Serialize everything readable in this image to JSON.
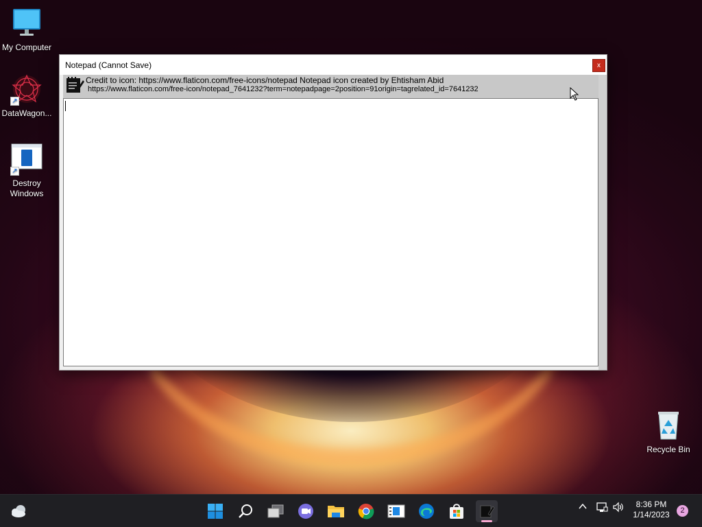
{
  "desktop": {
    "icons": [
      {
        "label": "My Computer"
      },
      {
        "label": "DataWagon..."
      },
      {
        "label": "Destroy Windows"
      },
      {
        "label": "Recycle Bin"
      }
    ]
  },
  "window": {
    "title": "Notepad (Cannot Save)",
    "close_label": "x",
    "credit_line1": "Credit to icon: https://www.flaticon.com/free-icons/notepad Notepad icon created by Ehtisham Abid",
    "credit_line2": "https://www.flaticon.com/free-icon/notepad_7641232?term=notepadpage=2position=91origin=tagrelated_id=7641232",
    "editor_text": ""
  },
  "taskbar": {
    "apps": [
      "start",
      "search",
      "task-view",
      "chat",
      "file-explorer",
      "chrome",
      "media-player",
      "edge",
      "store",
      "notepad"
    ],
    "active_app": "notepad",
    "clock_time": "8:36 PM",
    "clock_date": "1/14/2023",
    "notification_count": "2"
  }
}
